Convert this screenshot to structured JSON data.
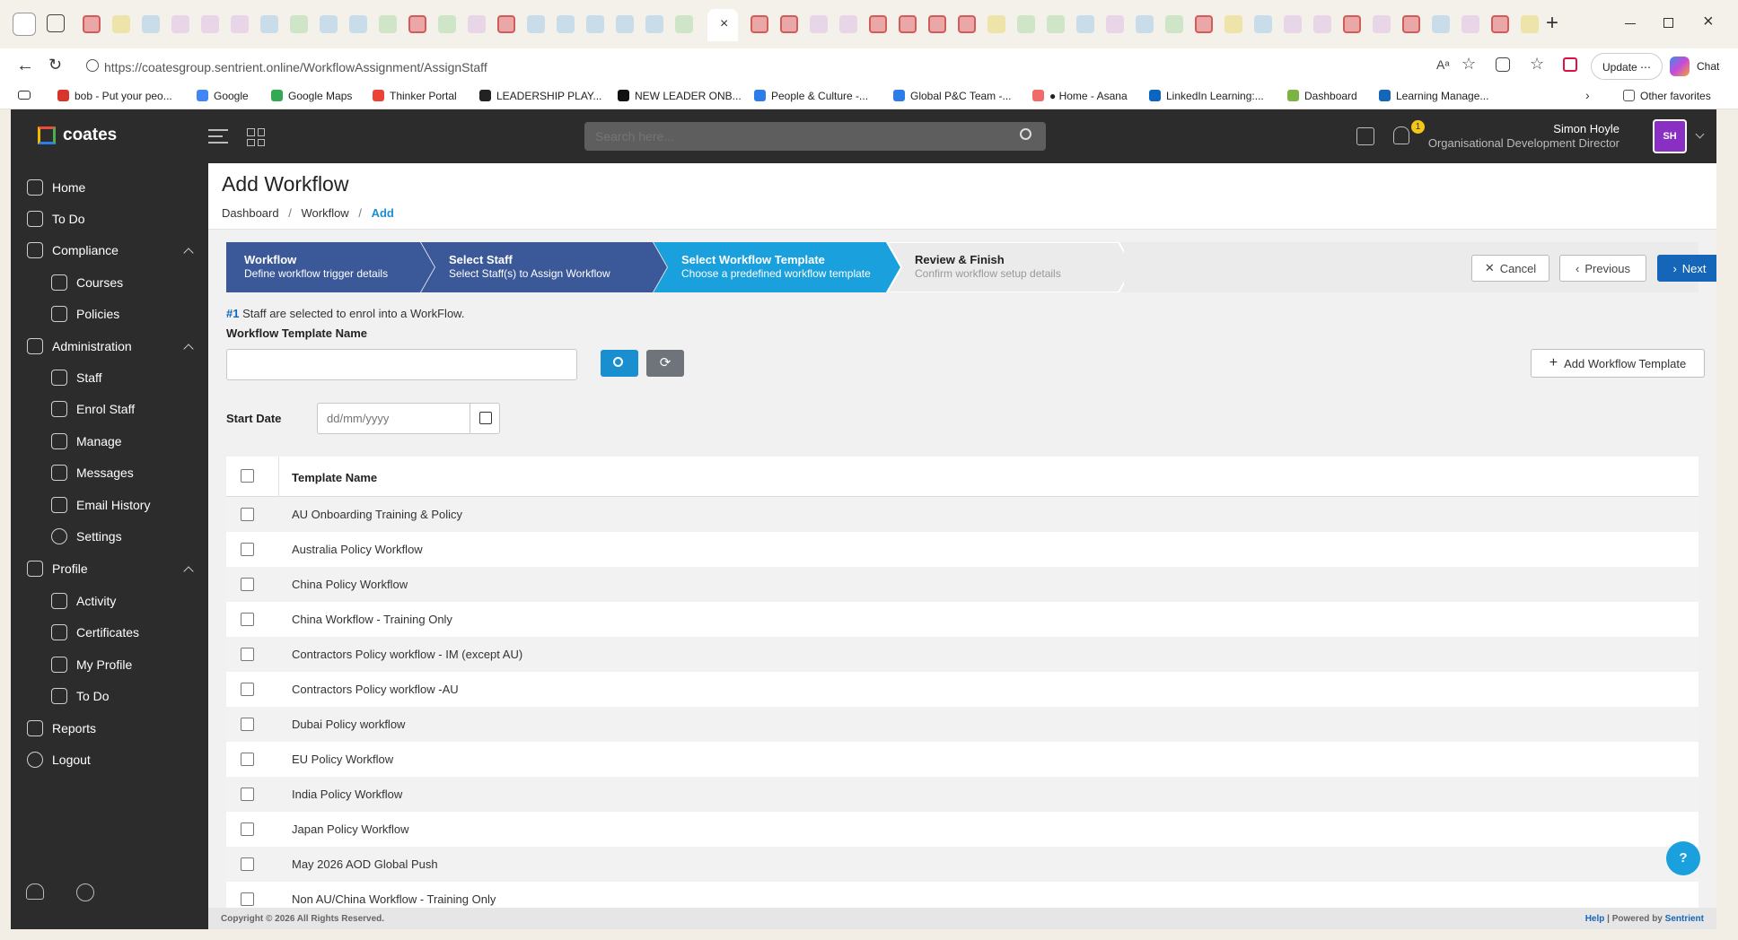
{
  "browser": {
    "url": "https://coatesgroup.sentrient.online/WorkflowAssignment/AssignStaff",
    "update_label": "Update",
    "chat_label": "Chat",
    "bookmarks": [
      "bob - Put your peo...",
      "Google",
      "Google Maps",
      "Thinker Portal",
      "LEADERSHIP PLAY...",
      "NEW LEADER ONB...",
      "People & Culture -...",
      "Global P&C Team -...",
      "● Home - Asana",
      "LinkedIn Learning:...",
      "Dashboard",
      "Learning Manage..."
    ],
    "other_favorites": "Other favorites"
  },
  "app": {
    "brand": "coates",
    "search_placeholder": "Search here...",
    "notification_count": "1",
    "user_name": "Simon Hoyle",
    "user_title": "Organisational Development Director",
    "user_initials": "SH"
  },
  "sidebar": {
    "home": "Home",
    "todo": "To Do",
    "compliance": "Compliance",
    "courses": "Courses",
    "policies": "Policies",
    "administration": "Administration",
    "staff": "Staff",
    "enrol_staff": "Enrol Staff",
    "manage": "Manage",
    "messages": "Messages",
    "email_history": "Email History",
    "settings": "Settings",
    "profile": "Profile",
    "activity": "Activity",
    "certificates": "Certificates",
    "my_profile": "My Profile",
    "profile_todo": "To Do",
    "reports": "Reports",
    "logout": "Logout"
  },
  "page": {
    "title": "Add Workflow",
    "breadcrumb": [
      "Dashboard",
      "Workflow",
      "Add"
    ],
    "steps": [
      {
        "title": "Workflow",
        "subtitle": "Define workflow trigger details",
        "state": "done"
      },
      {
        "title": "Select Staff",
        "subtitle": "Select Staff(s) to Assign Workflow",
        "state": "done"
      },
      {
        "title": "Select Workflow Template",
        "subtitle": "Choose a predefined workflow template",
        "state": "active"
      },
      {
        "title": "Review & Finish",
        "subtitle": "Confirm workflow setup details",
        "state": "todo"
      }
    ],
    "cancel_label": "Cancel",
    "previous_label": "Previous",
    "next_label": "Next",
    "selected_count": "#1",
    "selected_text": "Staff are selected to enrol into a WorkFlow.",
    "template_name_label": "Workflow Template Name",
    "template_name_value": "",
    "add_template_label": "Add Workflow Template",
    "start_date_label": "Start Date",
    "start_date_placeholder": "dd/mm/yyyy",
    "table_header": "Template Name",
    "templates": [
      "AU Onboarding Training & Policy",
      "Australia Policy Workflow",
      "China Policy Workflow",
      "China Workflow - Training Only",
      "Contractors Policy workflow - IM (except AU)",
      "Contractors Policy workflow -AU",
      "Dubai Policy workflow",
      "EU Policy Workflow",
      "India Policy Workflow",
      "Japan Policy Workflow",
      "May 2026 AOD Global Push",
      "Non AU/China Workflow - Training Only"
    ],
    "footer_copyright": "Copyright © 2026 All Rights Reserved.",
    "footer_help": "Help",
    "footer_powered": "| Powered by",
    "footer_brand": "Sentrient",
    "help_fab": "?"
  },
  "colors": {
    "step_done": "#3b5998",
    "step_active": "#1aa0dc",
    "primary_button": "#1565b8",
    "search_button": "#1a8fd0",
    "avatar": "#8a2fc4",
    "badge": "#f5c518"
  }
}
